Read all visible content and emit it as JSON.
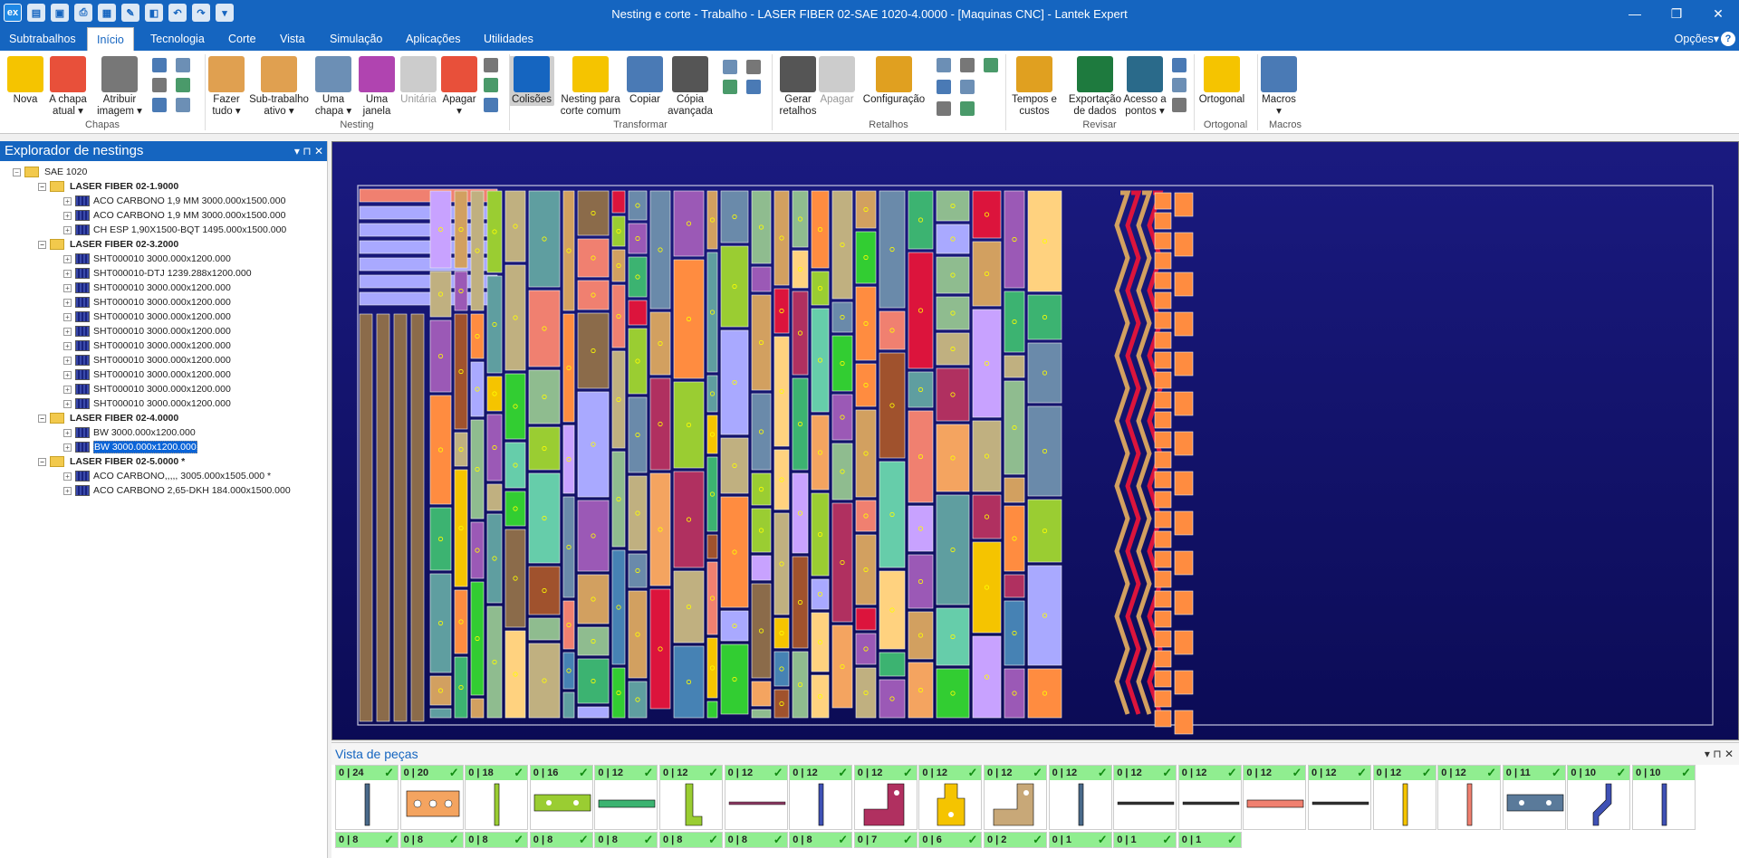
{
  "window": {
    "title": "Nesting e corte - Trabalho - LASER FIBER 02-SAE 1020-4.0000 - [Maquinas CNC] - Lantek Expert",
    "logo": "ex",
    "minimize": "—",
    "restore": "❐",
    "close": "✕"
  },
  "tabs": [
    {
      "label": "Subtrabalhos"
    },
    {
      "label": "Início"
    },
    {
      "label": "Tecnologia"
    },
    {
      "label": "Corte"
    },
    {
      "label": "Vista"
    },
    {
      "label": "Simulação"
    },
    {
      "label": "Aplicações"
    },
    {
      "label": "Utilidades"
    }
  ],
  "options_label": "Opções▾",
  "help_label": "?",
  "ribbon": {
    "buttons": [
      {
        "label": "Nova",
        "icon": "new-sheet-icon",
        "color": "#f5c400"
      },
      {
        "label": "A chapa atual ▾",
        "icon": "current-sheet-icon",
        "color": "#e8503a"
      },
      {
        "label": "Atribuir imagem ▾",
        "icon": "camera-icon",
        "color": "#777777"
      },
      {
        "label": "Fazer tudo ▾",
        "icon": "nest-all-icon",
        "color": "#e0a050"
      },
      {
        "label": "Sub-trabalho ativo ▾",
        "icon": "subjob-icon",
        "color": "#e0a050"
      },
      {
        "label": "Uma chapa ▾",
        "icon": "one-sheet-icon",
        "color": "#6c8fb5"
      },
      {
        "label": "Uma janela",
        "icon": "one-window-icon",
        "color": "#b044b0"
      },
      {
        "label": "Unitária",
        "icon": "unitary-icon",
        "color": "#cccccc"
      },
      {
        "label": "Apagar ▾",
        "icon": "erase-icon",
        "color": "#e8503a"
      },
      {
        "label": "Colisões",
        "icon": "collisions-icon",
        "color": "#1565c0"
      },
      {
        "label": "Nesting para corte comum",
        "icon": "common-cut-icon",
        "color": "#f5c400"
      },
      {
        "label": "Copiar",
        "icon": "copy-icon",
        "color": "#4a7ab5"
      },
      {
        "label": "Cópia avançada",
        "icon": "advanced-copy-icon",
        "color": "#555555"
      },
      {
        "label": "Gerar retalhos",
        "icon": "remnant-gear-icon",
        "color": "#555555"
      },
      {
        "label": "Apagar",
        "icon": "erase-remnant-icon",
        "color": "#cccccc"
      },
      {
        "label": "Configuração",
        "icon": "config-gear-icon",
        "color": "#e0a020"
      },
      {
        "label": "Tempos e custos",
        "icon": "coins-icon",
        "color": "#e0a020"
      },
      {
        "label": "Exportação de dados",
        "icon": "excel-icon",
        "color": "#1e7a3e"
      },
      {
        "label": "Acesso a pontos ▾",
        "icon": "points-access-icon",
        "color": "#2a6a8a"
      },
      {
        "label": "Ortogonal",
        "icon": "orthogonal-icon",
        "color": "#f5c400"
      },
      {
        "label": "Macros ▾",
        "icon": "macros-icon",
        "color": "#4a7ab5"
      }
    ],
    "groups": [
      "Chapas",
      "Nesting",
      "Transformar",
      "Retalhos",
      "Revisar",
      "Ortogonal",
      "Macros"
    ]
  },
  "explorer": {
    "title": "Explorador de nestings",
    "controls": "▾  ⊓  ✕",
    "root": "SAE 1020",
    "folders": [
      {
        "name": "LASER FIBER 02-1.9000",
        "items": [
          "ACO CARBONO 1,9 MM 3000.000x1500.000",
          "ACO CARBONO 1,9 MM 3000.000x1500.000",
          "CH ESP 1,90X1500-BQT 1495.000x1500.000"
        ]
      },
      {
        "name": "LASER FIBER 02-3.2000",
        "items": [
          "SHT000010 3000.000x1200.000",
          "SHT000010-DTJ 1239.288x1200.000",
          "SHT000010 3000.000x1200.000",
          "SHT000010 3000.000x1200.000",
          "SHT000010 3000.000x1200.000",
          "SHT000010 3000.000x1200.000",
          "SHT000010 3000.000x1200.000",
          "SHT000010 3000.000x1200.000",
          "SHT000010 3000.000x1200.000",
          "SHT000010 3000.000x1200.000",
          "SHT000010 3000.000x1200.000"
        ]
      },
      {
        "name": "LASER FIBER 02-4.0000",
        "items": [
          "BW 3000.000x1200.000",
          "BW 3000.000x1200.000"
        ]
      },
      {
        "name": "LASER FIBER 02-5.0000 *",
        "items": [
          "ACO CARBONO,,,,, 3005.000x1505.000 *",
          "ACO CARBONO 2,65-DKH 184.000x1500.000"
        ]
      }
    ],
    "selected": "BW 3000.000x1200.000"
  },
  "parts_view": {
    "title": "Vista de peças",
    "controls": "▾  ⊓  ✕",
    "row1": [
      {
        "count": "0 | 24",
        "shape": "vbar",
        "color": "#4a6a8a"
      },
      {
        "count": "0 | 20",
        "shape": "plate3",
        "color": "#f4a460"
      },
      {
        "count": "0 | 18",
        "shape": "vbar",
        "color": "#9acd32"
      },
      {
        "count": "0 | 16",
        "shape": "hplate",
        "color": "#9acd32"
      },
      {
        "count": "0 | 12",
        "shape": "hbar",
        "color": "#3cb371"
      },
      {
        "count": "0 | 12",
        "shape": "lshape",
        "color": "#9acd32"
      },
      {
        "count": "0 | 12",
        "shape": "hline",
        "color": "#8b3a62"
      },
      {
        "count": "0 | 12",
        "shape": "vbar",
        "color": "#3f51b5"
      },
      {
        "count": "0 | 12",
        "shape": "bigL",
        "color": "#b03060"
      },
      {
        "count": "0 | 12",
        "shape": "tshape",
        "color": "#f5c400"
      },
      {
        "count": "0 | 12",
        "shape": "bigL",
        "color": "#c8a878"
      },
      {
        "count": "0 | 12",
        "shape": "vbar",
        "color": "#4a6a8a"
      },
      {
        "count": "0 | 12",
        "shape": "hline",
        "color": "#333333"
      },
      {
        "count": "0 | 12",
        "shape": "hline",
        "color": "#333333"
      },
      {
        "count": "0 | 12",
        "shape": "hbar",
        "color": "#f08070"
      },
      {
        "count": "0 | 12",
        "shape": "hline",
        "color": "#333333"
      },
      {
        "count": "0 | 12",
        "shape": "vbar",
        "color": "#f5c400"
      },
      {
        "count": "0 | 12",
        "shape": "vbar",
        "color": "#f08070"
      },
      {
        "count": "0 | 11",
        "shape": "hplate",
        "color": "#5a7a9a"
      },
      {
        "count": "0 | 10",
        "shape": "zbar",
        "color": "#3f51b5"
      },
      {
        "count": "0 | 10",
        "shape": "vbar",
        "color": "#3f51b5"
      }
    ],
    "row2": [
      "0 | 8",
      "0 | 8",
      "0 | 8",
      "0 | 8",
      "0 | 8",
      "0 | 8",
      "0 | 8",
      "0 | 8",
      "0 | 7",
      "0 | 6",
      "0 | 2",
      "0 | 1",
      "0 | 1",
      "0 | 1"
    ],
    "check": "✓"
  },
  "nest_palette": [
    "#f08070",
    "#9b59b6",
    "#c8a2ff",
    "#a9a9ff",
    "#f5c400",
    "#32cd32",
    "#3cb371",
    "#8fbc8f",
    "#9acd32",
    "#c0b080",
    "#d2a060",
    "#f4a460",
    "#ff8c40",
    "#dc143c",
    "#5f9ea0",
    "#4682b4",
    "#66cdaa",
    "#b03060",
    "#8b6b4a",
    "#6a8aaa",
    "#ffd27f",
    "#a0522d"
  ]
}
